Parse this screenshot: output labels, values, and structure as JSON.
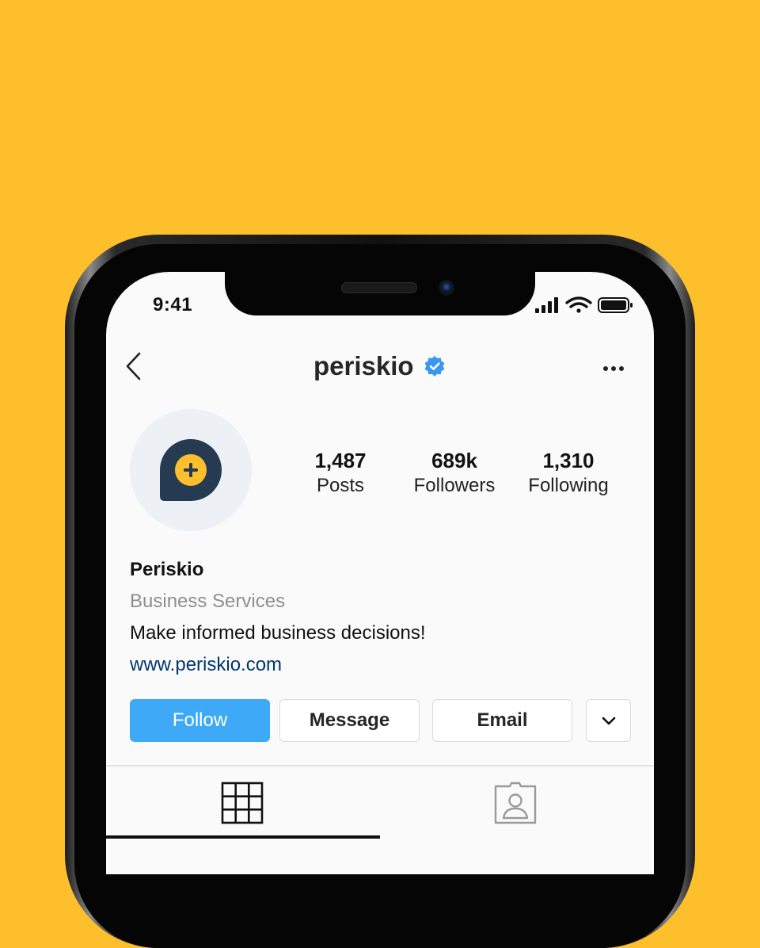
{
  "status_bar": {
    "time": "9:41"
  },
  "header": {
    "username": "periskio",
    "verified": true
  },
  "profile": {
    "stats": [
      {
        "value": "1,487",
        "label": "Posts"
      },
      {
        "value": "689k",
        "label": "Followers"
      },
      {
        "value": "1,310",
        "label": "Following"
      }
    ],
    "name": "Periskio",
    "category": "Business Services",
    "bio": "Make informed business decisions!",
    "website": "www.periskio.com"
  },
  "actions": {
    "follow_label": "Follow",
    "message_label": "Message",
    "email_label": "Email",
    "more_icon": "chevron-down-icon"
  },
  "tabs": [
    {
      "icon": "grid-icon",
      "active": true
    },
    {
      "icon": "tagged-user-icon",
      "active": false
    }
  ],
  "colors": {
    "background": "#FDBF2C",
    "follow_button": "#3EA9F6",
    "verified_badge": "#3897F0",
    "link": "#00376B",
    "logo_dark": "#263A52",
    "logo_accent": "#FDBF2C"
  }
}
